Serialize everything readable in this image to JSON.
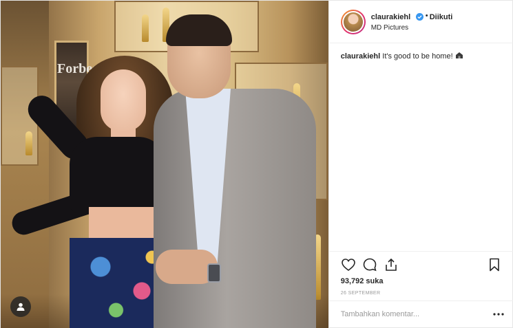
{
  "post": {
    "username": "claurakiehl",
    "follow_status": "Diikuti",
    "dot": "•",
    "location": "MD Pictures",
    "caption_user": "claurakiehl",
    "caption_text": " It's good to be home! ",
    "poster_text": "Forbes",
    "likes_count": "93,792",
    "likes_suffix": " suka",
    "date": "26 SEPTEMBER",
    "comment_placeholder": "Tambahkan komentar...",
    "colors": {
      "verified": "#3897f0",
      "text": "#262626",
      "muted": "#999999"
    },
    "icons": {
      "like": "heart-icon",
      "comment": "comment-icon",
      "share": "share-icon",
      "save": "bookmark-icon",
      "verified": "verified-badge-icon",
      "tagged_users": "user-tag-icon",
      "options": "more-options-icon"
    }
  }
}
